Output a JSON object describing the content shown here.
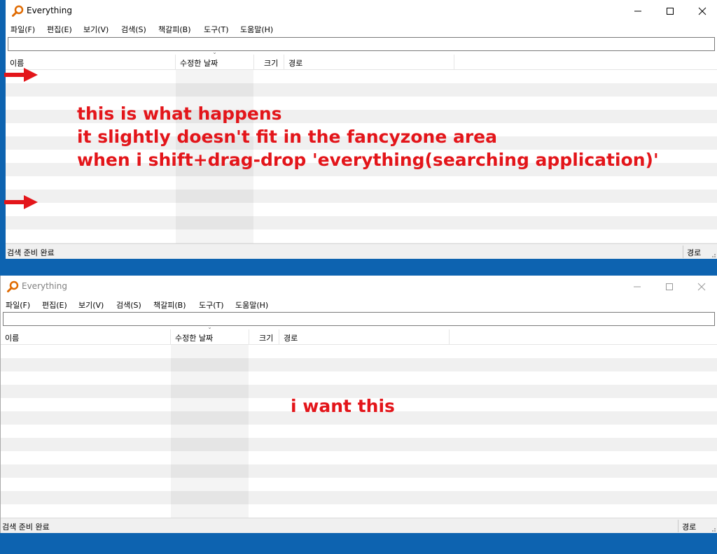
{
  "window_top": {
    "title": "Everything",
    "menu": [
      "파일(F)",
      "편집(E)",
      "보기(V)",
      "검색(S)",
      "책갈피(B)",
      "도구(T)",
      "도움말(H)"
    ],
    "columns": {
      "name": "이름",
      "modified": "수정한 날짜",
      "size": "크기",
      "path": "경로"
    },
    "status": "검색 준비 완료",
    "status_right": "경로"
  },
  "window_bottom": {
    "title": "Everything",
    "menu": [
      "파일(F)",
      "편집(E)",
      "보기(V)",
      "검색(S)",
      "책갈피(B)",
      "도구(T)",
      "도움말(H)"
    ],
    "columns": {
      "name": "이름",
      "modified": "수정한 날짜",
      "size": "크기",
      "path": "경로"
    },
    "status": "검색 준비 완료",
    "status_right": "경로"
  },
  "annotations": {
    "top_lines": [
      "this is what happens",
      "it slightly doesn't fit in the fancyzone area",
      "when i shift+drag-drop 'everything(searching application)'"
    ],
    "bottom_text": "i want this"
  },
  "colors": {
    "desktop": "#0d63b0",
    "annotation": "#e3151a",
    "app_icon": "#e06a00"
  },
  "icons": [
    "magnifier-app-icon",
    "minimize-icon",
    "maximize-icon",
    "close-icon",
    "red-arrow-icon",
    "resize-grip-icon"
  ]
}
